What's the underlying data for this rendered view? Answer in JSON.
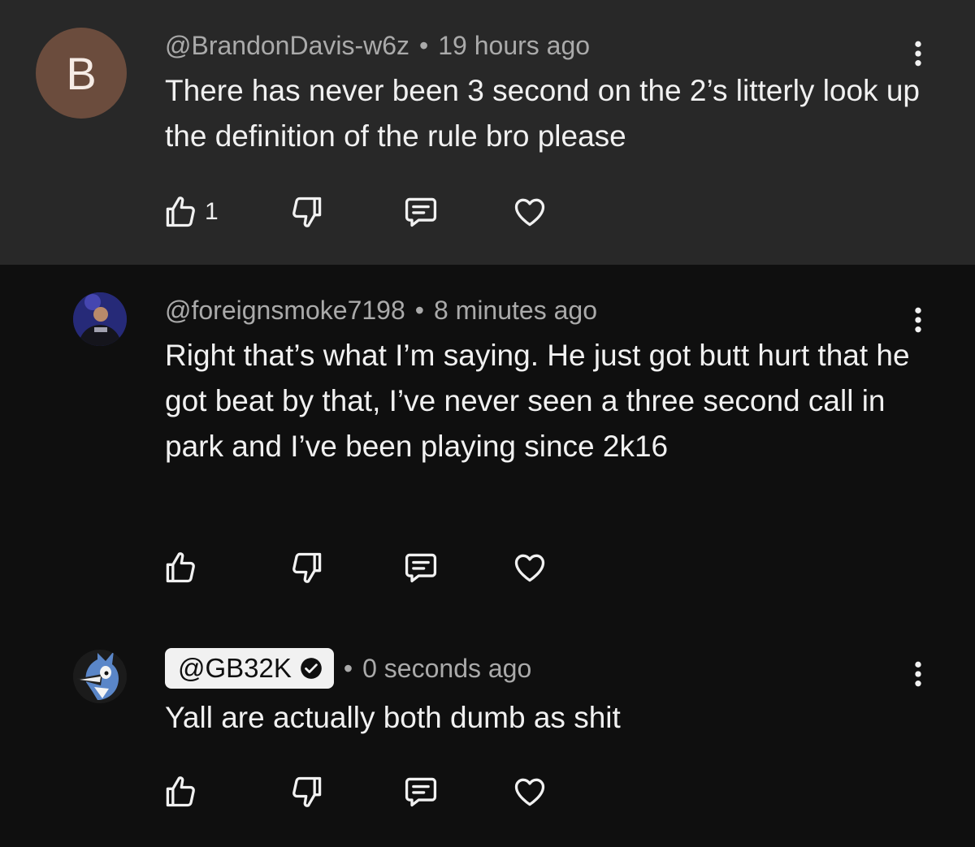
{
  "comments": [
    {
      "avatar_letter": "B",
      "handle": "@BrandonDavis-w6z",
      "time": "19 hours ago",
      "text": "There has never been 3 second on the 2’s litterly look up the definition of the rule bro please",
      "like_count": "1"
    },
    {
      "handle": "@foreignsmoke7198",
      "time": "8 minutes ago",
      "text": "Right that’s what I’m saying. He just got butt hurt that he got beat by that, I’ve never seen a three second call in park and I’ve been playing since 2k16"
    },
    {
      "handle": "@GB32K",
      "time": "0 seconds ago",
      "text": "Yall are actually both dumb as shit"
    }
  ],
  "separator": "•",
  "icons": {
    "like": "thumbs-up-icon",
    "dislike": "thumbs-down-icon",
    "reply": "reply-icon",
    "heart": "heart-icon",
    "more": "more-vertical-icon",
    "verified": "verified-check-icon"
  },
  "colors": {
    "background": "#0f0f0f",
    "highlighted_background": "#282828",
    "meta_text": "#aaaaaa",
    "text": "#f1f1f1",
    "avatar_b": "#6b4c3d"
  }
}
